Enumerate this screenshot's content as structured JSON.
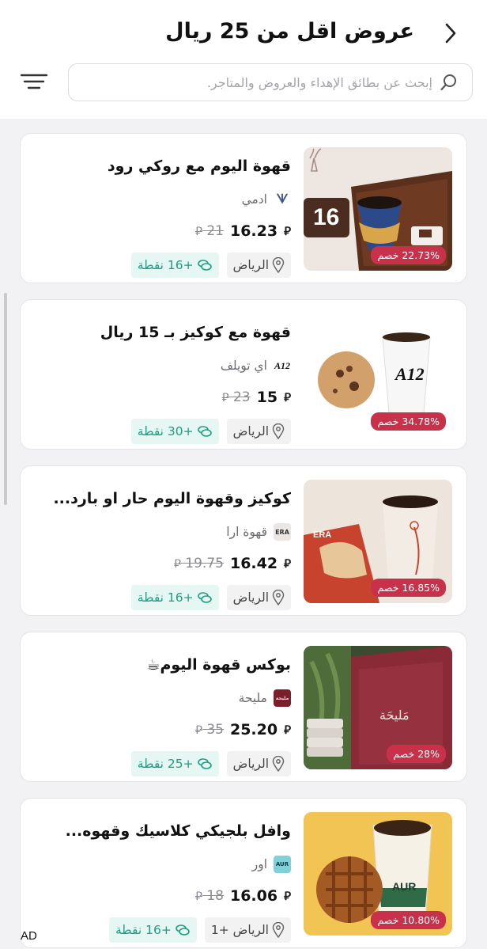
{
  "header": {
    "title": "عروض اقل من 25 ريال",
    "back_icon": "chevron-right-icon",
    "filter_icon": "filter-lines-icon"
  },
  "search": {
    "placeholder": "إبحث عن بطائق الإهداء والعروض والمتاجر.",
    "value": ""
  },
  "currency_symbol": "⃁",
  "offers": [
    {
      "title": "قهوة اليوم مع روكي رود",
      "brand": "ادمي",
      "brand_logo_text": "ᗐ",
      "price": "16.23",
      "old_price": "21",
      "discount": "22.73% خصم",
      "location": "الرياض",
      "points": "+16 نقطة",
      "image_badge": "16"
    },
    {
      "title": "قهوة مع كوكيز بـ 15 ريال",
      "brand": "اي تويلف",
      "brand_logo_text": "A12",
      "price": "15",
      "old_price": "23",
      "discount": "34.78% خصم",
      "location": "الرياض",
      "points": "+30 نقطة",
      "image_badge": "A12"
    },
    {
      "title": "كوكيز وقهوة اليوم حار او بارد...",
      "brand": "قهوة ارا",
      "brand_logo_text": "ERA",
      "price": "16.42",
      "old_price": "19.75",
      "discount": "16.85% خصم",
      "location": "الرياض",
      "points": "+16 نقطة",
      "image_badge": "ERA"
    },
    {
      "title": "بوكس قهوة اليوم☕",
      "brand": "مليحة",
      "brand_logo_text": "مليحة",
      "price": "25.20",
      "old_price": "35",
      "discount": "28% خصم",
      "location": "الرياض",
      "points": "+25 نقطة",
      "image_badge": "مَليحَة"
    },
    {
      "title": "وافل بلجيكي كلاسيك وقهوه...",
      "brand": "اور",
      "brand_logo_text": "AUR",
      "price": "16.06",
      "old_price": "18",
      "discount": "10.80% خصم",
      "location": "الرياض +1",
      "points": "+16 نقطة",
      "image_badge": "AUR"
    }
  ],
  "ad_label": "AD",
  "colors": {
    "discount_bg": "#c9314a",
    "points_text": "#1b9e83",
    "points_bg": "#e6f6f2"
  }
}
